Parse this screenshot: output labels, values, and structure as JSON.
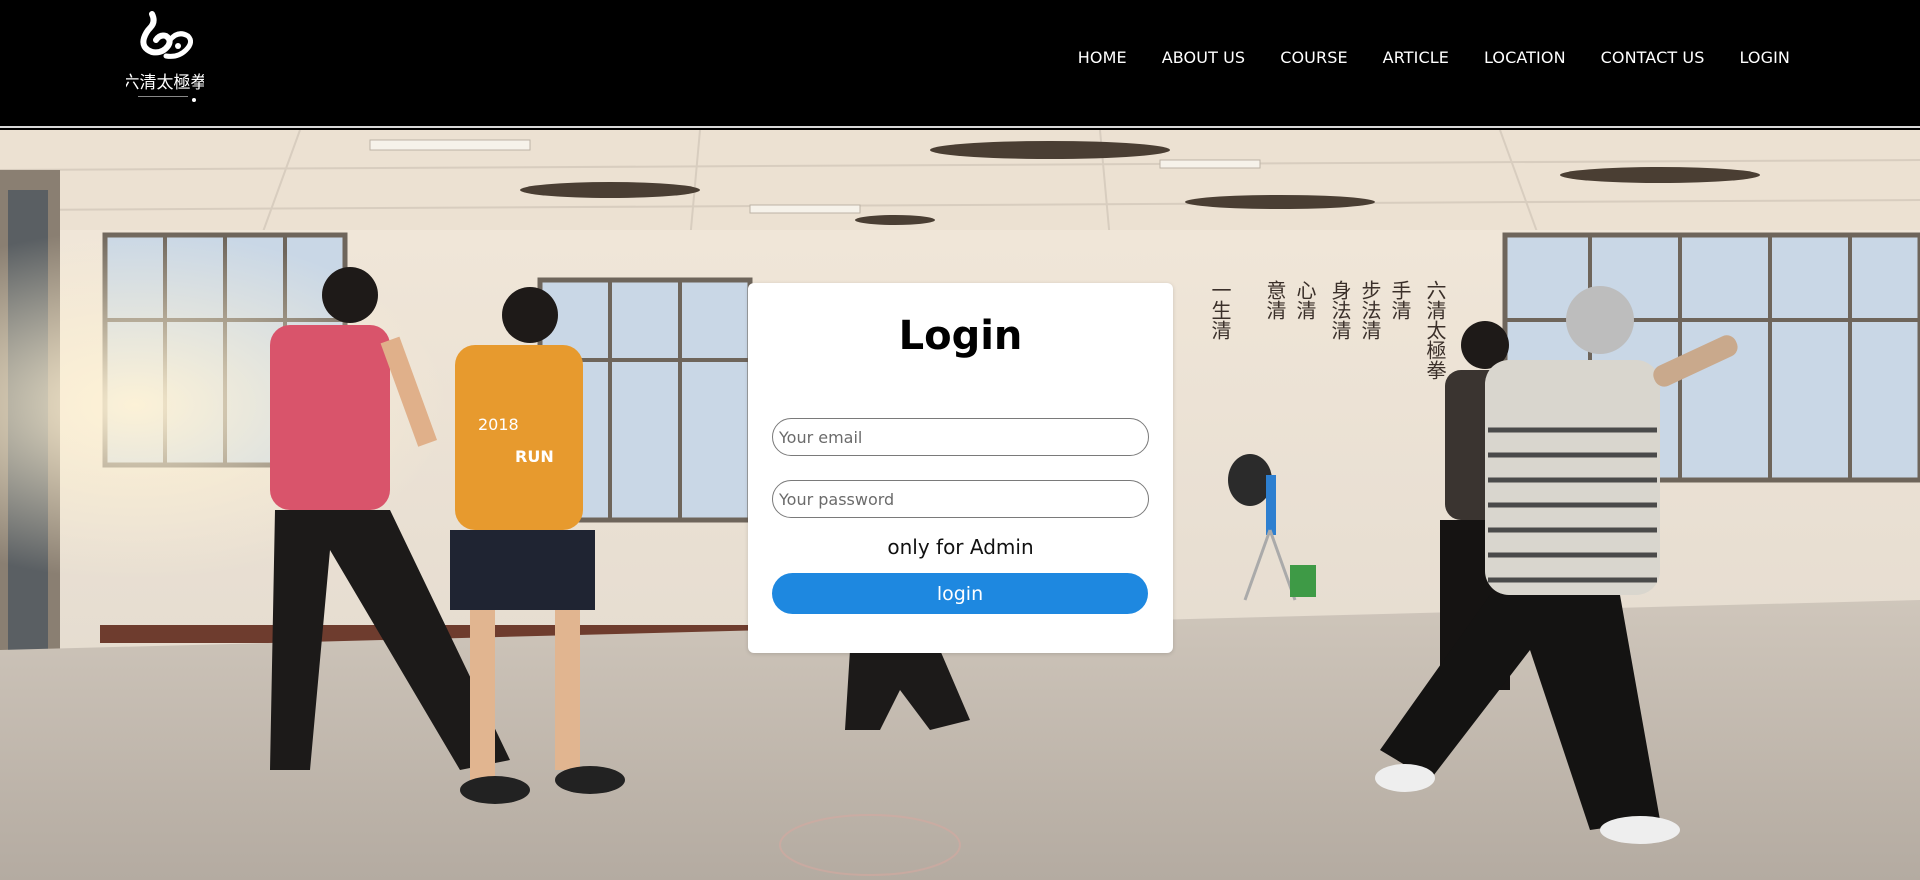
{
  "header": {
    "logo_text": "六清太極拳",
    "nav": [
      {
        "label": "HOME"
      },
      {
        "label": "ABOUT US"
      },
      {
        "label": "COURSE"
      },
      {
        "label": "ARTICLE"
      },
      {
        "label": "LOCATION"
      },
      {
        "label": "CONTACT US"
      },
      {
        "label": "LOGIN"
      }
    ]
  },
  "login": {
    "title": "Login",
    "email_placeholder": "Your email",
    "email_value": "",
    "password_placeholder": "Your password",
    "password_value": "",
    "note": "only for Admin",
    "button_label": "login"
  },
  "colors": {
    "header_bg": "#000000",
    "button_bg": "#1e88e0",
    "card_bg": "#ffffff"
  },
  "background": {
    "icon": "tai-chi-class-photo",
    "shirt_text_1": "2018",
    "shirt_text_2": "RUN"
  }
}
